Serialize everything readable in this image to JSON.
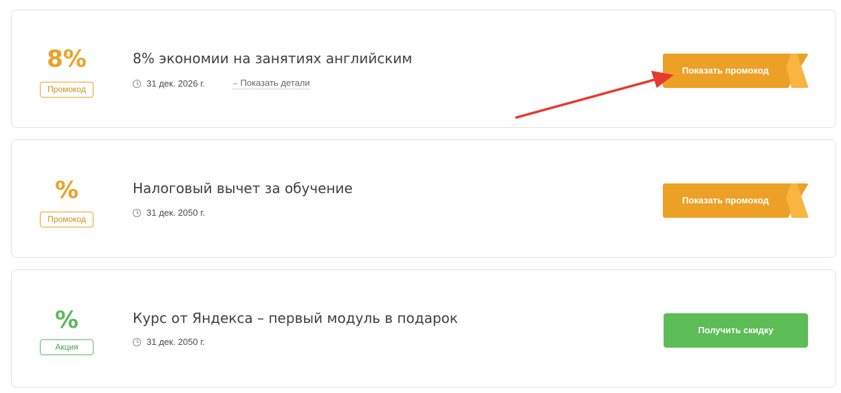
{
  "offers": [
    {
      "discount": "8%",
      "tag": "Промокод",
      "title": "8% экономии на занятиях английским",
      "date": "31 дек. 2026 г.",
      "details_label": "Показать детали",
      "button_label": "Показать промокод"
    },
    {
      "discount": "%",
      "tag": "Промокод",
      "title": "Налоговый вычет за обучение",
      "date": "31 дек. 2050 г.",
      "button_label": "Показать промокод"
    },
    {
      "discount": "%",
      "tag": "Акция",
      "title": "Курс от Яндекса – первый модуль в подарок",
      "date": "31 дек. 2050 г.",
      "button_label": "Получить скидку"
    }
  ],
  "colors": {
    "promo_orange": "#eca126",
    "deal_green": "#5cbc55",
    "annotation_arrow": "#e8392f"
  },
  "icons": [
    "clock-icon",
    "chevron-down-icon",
    "annotation-arrow"
  ]
}
